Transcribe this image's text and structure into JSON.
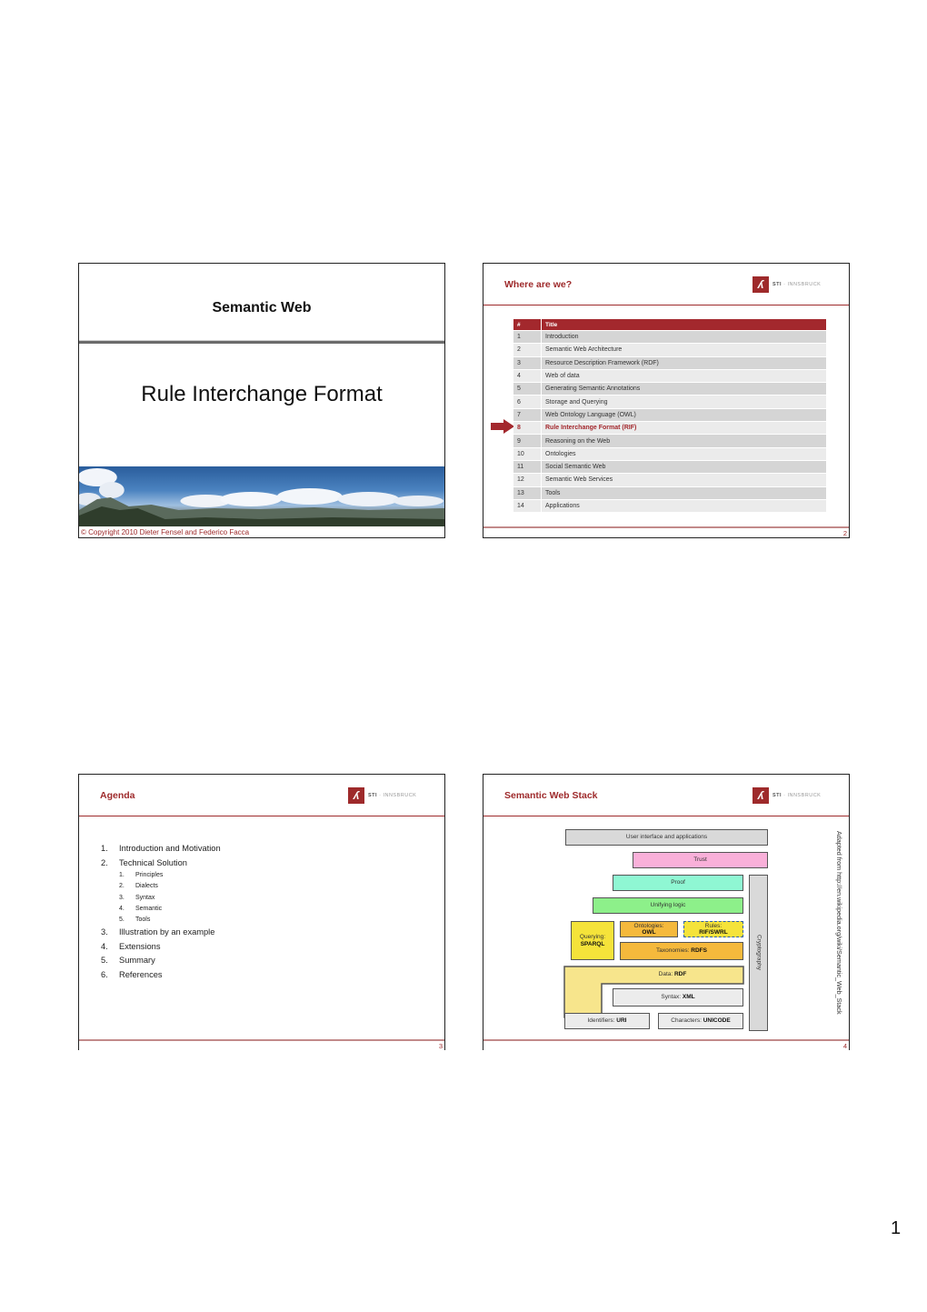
{
  "page_number": "1",
  "slides": {
    "s1": {
      "course_title": "Semantic Web",
      "lecture_title": "Rule Interchange Format",
      "copyright": "© Copyright 2010   Dieter Fensel and Federico Facca"
    },
    "s2": {
      "title": "Where are we?",
      "logo": {
        "mark": "ʎ",
        "brand": "STI",
        "sep": " · ",
        "place": "INNSBRUCK"
      },
      "table": {
        "headers": [
          "#",
          "Title"
        ],
        "rows": [
          {
            "num": "1",
            "title": "Introduction"
          },
          {
            "num": "2",
            "title": "Semantic Web Architecture"
          },
          {
            "num": "3",
            "title": "Resource Description Framework (RDF)"
          },
          {
            "num": "4",
            "title": "Web of data"
          },
          {
            "num": "5",
            "title": "Generating Semantic Annotations"
          },
          {
            "num": "6",
            "title": "Storage and Querying"
          },
          {
            "num": "7",
            "title": "Web Ontology Language (OWL)"
          },
          {
            "num": "8",
            "title": "Rule Interchange Format (RIF)",
            "current": true
          },
          {
            "num": "9",
            "title": "Reasoning on the Web"
          },
          {
            "num": "10",
            "title": "Ontologies"
          },
          {
            "num": "11",
            "title": "Social Semantic Web"
          },
          {
            "num": "12",
            "title": "Semantic Web Services"
          },
          {
            "num": "13",
            "title": "Tools"
          },
          {
            "num": "14",
            "title": "Applications"
          }
        ]
      },
      "accent_color": "#a3282d",
      "page": "2"
    },
    "s3": {
      "title": "Agenda",
      "items": [
        {
          "num": "1.",
          "label": "Introduction and Motivation"
        },
        {
          "num": "2.",
          "label": "Technical Solution",
          "sub": [
            {
              "num": "1.",
              "label": "Principles"
            },
            {
              "num": "2.",
              "label": "Dialects"
            },
            {
              "num": "3.",
              "label": "Syntax"
            },
            {
              "num": "4.",
              "label": "Semantic"
            },
            {
              "num": "5.",
              "label": "Tools"
            }
          ]
        },
        {
          "num": "3.",
          "label": "Illustration by an example"
        },
        {
          "num": "4.",
          "label": "Extensions"
        },
        {
          "num": "5.",
          "label": "Summary"
        },
        {
          "num": "6.",
          "label": "References"
        }
      ],
      "page": "3"
    },
    "s4": {
      "title": "Semantic Web Stack",
      "layers": {
        "ui": "User interface and applications",
        "trust": "Trust",
        "proof": "Proof",
        "logic": "Unifying logic",
        "querying_a": "Querying:",
        "querying_b": "SPARQL",
        "ontologies_a": "Ontologies:",
        "ontologies_b": "OWL",
        "rules_a": "Rules:",
        "rules_b": "RIF/SWRL",
        "taxonomies_a": "Taxonomies: ",
        "taxonomies_b": "RDFS",
        "data_a": "Data: ",
        "data_b": "RDF",
        "syntax_a": "Syntax: ",
        "syntax_b": "XML",
        "identifiers_a": "Identifiers: ",
        "identifiers_b": "URI",
        "characters_a": "Characters: ",
        "characters_b": "UNICODE",
        "crypto": "Cryptography"
      },
      "colors": {
        "ui": "#d9d9d9",
        "trust": "#f9b0d9",
        "proof": "#8ff7d3",
        "logic": "#8df08a",
        "querying": "#f5e33a",
        "ontologies": "#f5b93c",
        "rules": "#f5e33a",
        "data": "#f7e58c",
        "syntax": "#ececec",
        "crypto": "#d9d9d9"
      },
      "credit": "Adapted from http://en.wikipedia.org/wiki/Semantic_Web_Stack",
      "page": "4"
    }
  }
}
